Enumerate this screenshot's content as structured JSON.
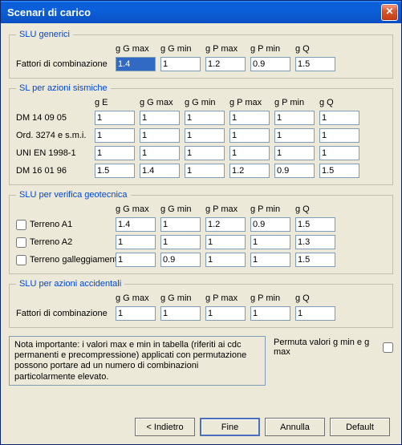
{
  "title": "Scenari di carico",
  "closeGlyph": "✕",
  "groups": {
    "generici": {
      "legend": "SLU generici",
      "headers": [
        "g G max",
        "g G min",
        "g P max",
        "g P min",
        "g Q"
      ],
      "rowLabel": "Fattori di combinazione",
      "values": [
        "1.4",
        "1",
        "1.2",
        "0.9",
        "1.5"
      ]
    },
    "sismiche": {
      "legend": "SL per azioni sismiche",
      "headers": [
        "g E",
        "g G max",
        "g G min",
        "g P max",
        "g P min",
        "g Q"
      ],
      "rows": [
        {
          "label": "DM 14 09 05",
          "v": [
            "1",
            "1",
            "1",
            "1",
            "1",
            "1"
          ]
        },
        {
          "label": "Ord. 3274 e s.m.i.",
          "v": [
            "1",
            "1",
            "1",
            "1",
            "1",
            "1"
          ]
        },
        {
          "label": "UNI EN 1998-1",
          "v": [
            "1",
            "1",
            "1",
            "1",
            "1",
            "1"
          ]
        },
        {
          "label": "DM 16 01 96",
          "v": [
            "1.5",
            "1.4",
            "1",
            "1.2",
            "0.9",
            "1.5"
          ]
        }
      ]
    },
    "geo": {
      "legend": "SLU per verifica geotecnica",
      "headers": [
        "g G max",
        "g G min",
        "g P max",
        "g P min",
        "g Q"
      ],
      "rows": [
        {
          "label": "Terreno A1",
          "v": [
            "1.4",
            "1",
            "1.2",
            "0.9",
            "1.5"
          ]
        },
        {
          "label": "Terreno A2",
          "v": [
            "1",
            "1",
            "1",
            "1",
            "1.3"
          ]
        },
        {
          "label": "Terreno galleggiamento",
          "v": [
            "1",
            "0.9",
            "1",
            "1",
            "1.5"
          ]
        }
      ]
    },
    "accidentali": {
      "legend": "SLU per azioni accidentali",
      "headers": [
        "g G max",
        "g G min",
        "g P max",
        "g P min",
        "g Q"
      ],
      "rowLabel": "Fattori di combinazione",
      "values": [
        "1",
        "1",
        "1",
        "1",
        "1"
      ]
    }
  },
  "note": "Nota importante: i valori max e min in tabella (riferiti ai cdc permanenti e precompressione) applicati con permutazione possono portare ad un numero di combinazioni particolarmente elevato.",
  "permuta": "Permuta valori g min e g max",
  "buttons": {
    "back": "< Indietro",
    "finish": "Fine",
    "cancel": "Annulla",
    "defaultBtn": "Default"
  }
}
